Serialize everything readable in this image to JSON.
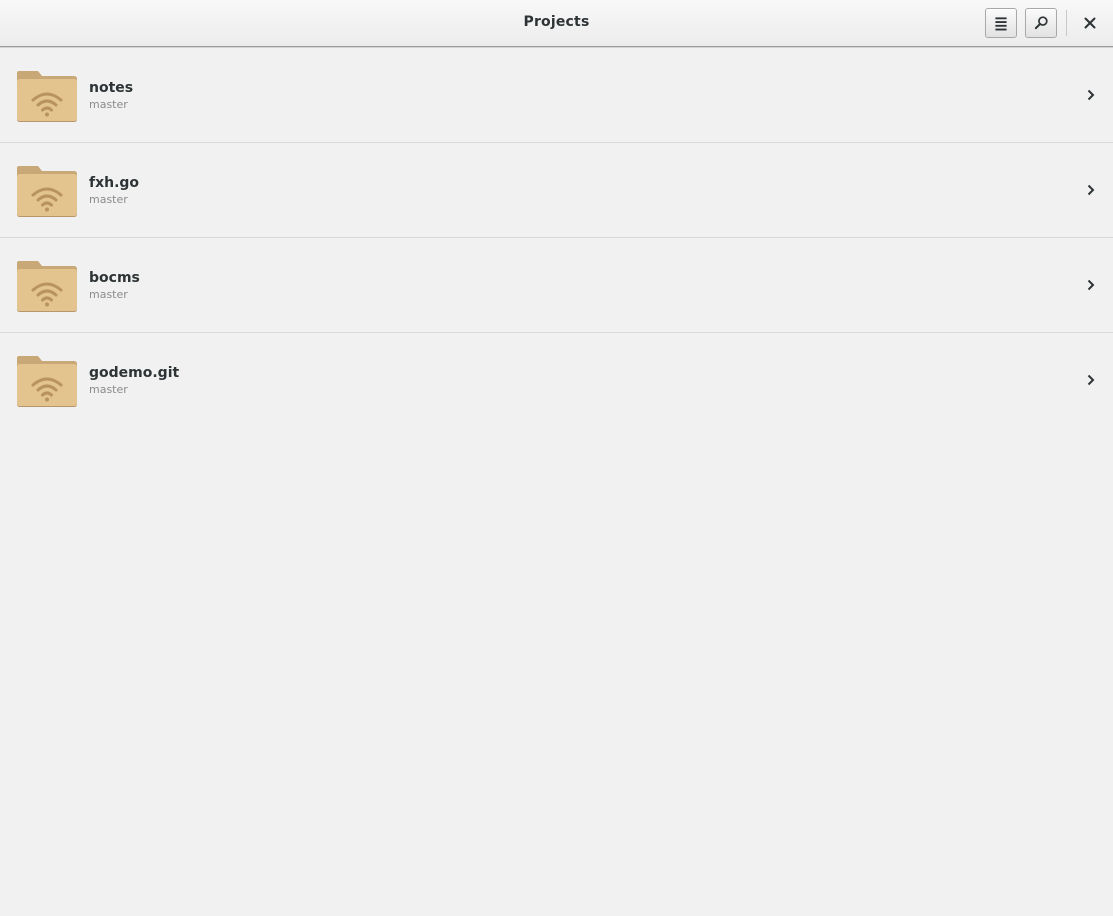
{
  "window": {
    "title": "Projects"
  },
  "toolbar": {
    "menu_icon": "hamburger-menu-icon",
    "search_icon": "search-icon",
    "close_icon": "close-icon"
  },
  "projects": [
    {
      "name": "notes",
      "branch": "master",
      "icon": "remote-folder-icon"
    },
    {
      "name": "fxh.go",
      "branch": "master",
      "icon": "remote-folder-icon"
    },
    {
      "name": "bocms",
      "branch": "master",
      "icon": "remote-folder-icon"
    },
    {
      "name": "godemo.git",
      "branch": "master",
      "icon": "remote-folder-icon"
    }
  ],
  "colors": {
    "background": "#f1f1f1",
    "folder": "#e3c38e",
    "folder_tab": "#c9a878",
    "text": "#2e3436"
  }
}
